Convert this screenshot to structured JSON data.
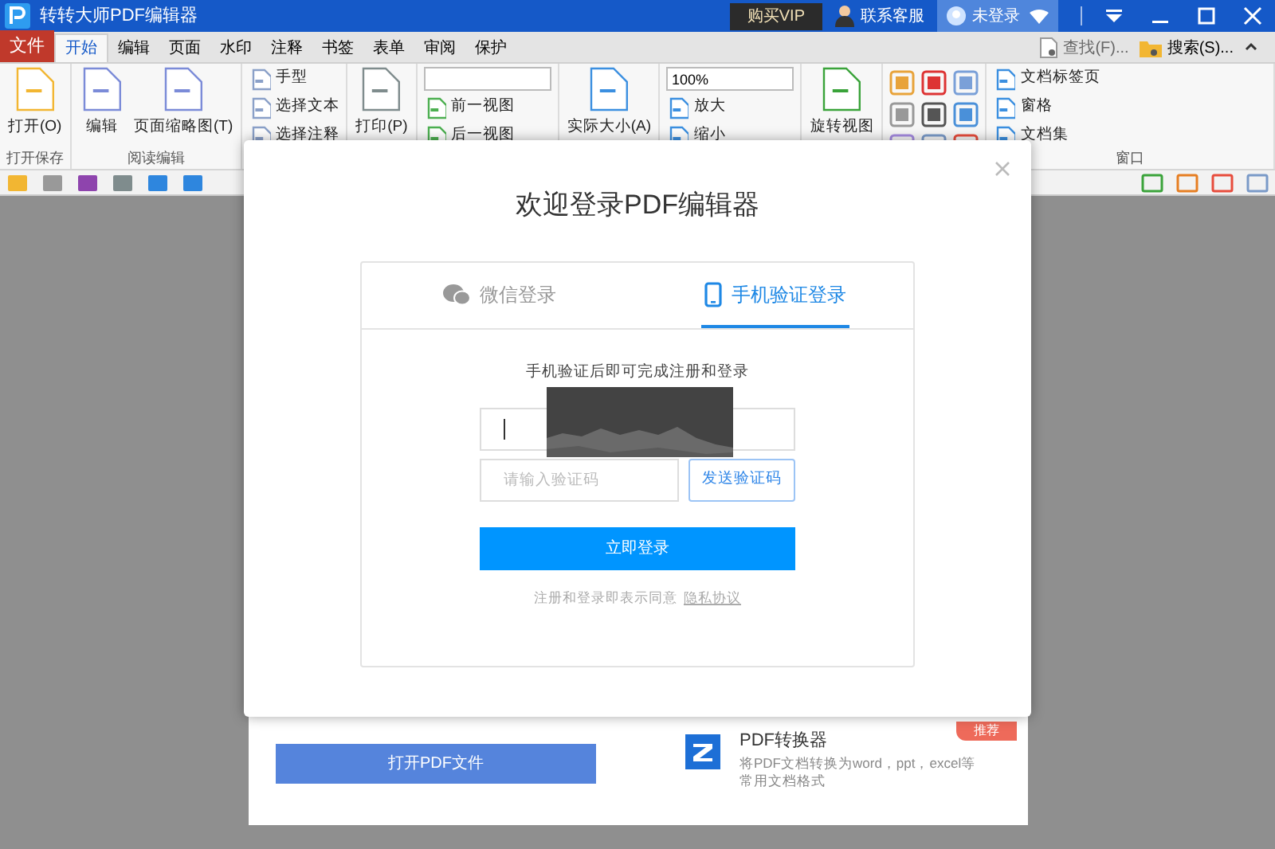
{
  "window": {
    "title": "转转大师PDF编辑器",
    "buttons": [
      {
        "kind": "vip",
        "label": "购买VIP"
      },
      {
        "kind": "service",
        "label": "联系客服"
      },
      {
        "kind": "account",
        "label": "未登录"
      }
    ]
  },
  "menu_tabs": [
    {
      "label": "文件",
      "kind": "file",
      "selected": false
    },
    {
      "label": "开始",
      "selected": true
    },
    {
      "label": "编辑",
      "selected": false
    },
    {
      "label": "页面",
      "selected": false
    },
    {
      "label": "水印",
      "selected": false
    },
    {
      "label": "注释",
      "selected": false
    },
    {
      "label": "书签",
      "selected": false
    },
    {
      "label": "表单",
      "selected": false
    },
    {
      "label": "审阅",
      "selected": false
    },
    {
      "label": "保护",
      "selected": false
    }
  ],
  "search_links": [
    "查找(F)...",
    "搜索(S)..."
  ],
  "ribbon": {
    "groups": [
      {
        "label": "打开保存",
        "items": [
          {
            "kind": "large",
            "label": "打开(O)"
          }
        ]
      },
      {
        "label": "阅读编辑",
        "items": [
          {
            "kind": "large",
            "label": "编辑"
          },
          {
            "kind": "large",
            "label": "页面缩略图(T)"
          }
        ]
      },
      {
        "items": [
          {
            "kind": "small",
            "label": "手型"
          },
          {
            "kind": "small",
            "label": "选择文本"
          },
          {
            "kind": "small",
            "label": "选择注释"
          }
        ]
      },
      {
        "items": [
          {
            "kind": "large",
            "label": "打印(P)"
          }
        ]
      },
      {
        "items": [
          {
            "kind": "field",
            "value": ""
          },
          {
            "kind": "small",
            "label": "前一视图"
          },
          {
            "kind": "small",
            "label": "后一视图"
          }
        ]
      },
      {
        "items": [
          {
            "kind": "large",
            "label": "实际大小(A)"
          }
        ]
      },
      {
        "items": [
          {
            "kind": "field",
            "value": "100%"
          },
          {
            "kind": "small",
            "label": "放大"
          },
          {
            "kind": "small",
            "label": "缩小"
          }
        ]
      },
      {
        "items": [
          {
            "kind": "large",
            "label": "旋转视图"
          }
        ]
      },
      {
        "items": [
          {
            "kind": "icons"
          }
        ]
      },
      {
        "label": "窗口",
        "items": [
          {
            "kind": "small",
            "label": "文档标签页"
          },
          {
            "kind": "small",
            "label": "窗格"
          },
          {
            "kind": "small",
            "label": "文档集"
          }
        ]
      }
    ]
  },
  "start_page": {
    "open_button": "打开PDF文件",
    "promo": {
      "title": "PDF转换器",
      "description": "将PDF文档转换为word，ppt，excel等常用文档格式",
      "badge": "推荐"
    }
  },
  "dialog": {
    "title": "欢迎登录PDF编辑器",
    "tabs": [
      {
        "label": "微信登录",
        "kind": "wechat",
        "selected": false
      },
      {
        "label": "手机验证登录",
        "kind": "phone",
        "selected": true
      }
    ],
    "hint": "手机验证后即可完成注册和登录",
    "phone_field": {
      "focused": true
    },
    "code_field": {
      "placeholder": "请输入验证码"
    },
    "send_button": "发送验证码",
    "login_button": "立即登录",
    "agreement": {
      "text": "注册和登录即表示同意",
      "link": "隐私协议"
    }
  }
}
